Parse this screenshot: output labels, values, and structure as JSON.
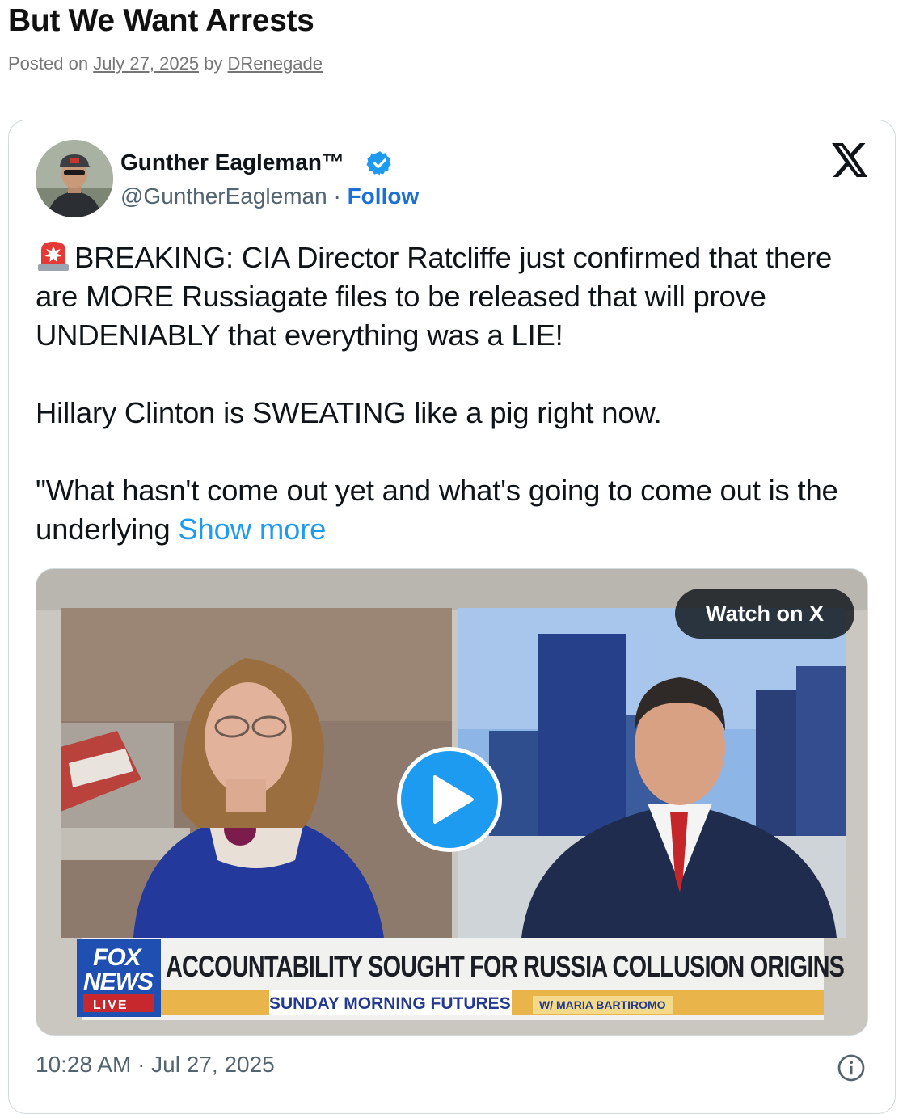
{
  "post": {
    "title": "But We Want Arrests",
    "meta_prefix": "Posted on ",
    "date": "July 27, 2025",
    "by": " by ",
    "author": "DRenegade"
  },
  "tweet": {
    "author_name": "Gunther Eagleman™",
    "handle": "@GuntherEagleman",
    "separator": " · ",
    "follow_label": "Follow",
    "text_line1": "BREAKING: CIA Director Ratcliffe just confirmed that there are MORE Russiagate files to be released that will prove UNDENIABLY that everything was a LIE!",
    "text_line2": "Hillary Clinton is SWEATING like a pig right now.",
    "text_line3": "\"What hasn't come out yet and what's going to come out is the underlying ",
    "show_more": "Show more",
    "timestamp": "10:28 AM · Jul 27, 2025",
    "icons": {
      "verified": "verified-badge-icon",
      "platform": "x-logo-icon",
      "siren": "rotating-light-emoji",
      "info": "info-icon",
      "play": "play-icon"
    },
    "colors": {
      "accent": "#1d9bf0",
      "follow": "#1d6fd6",
      "muted": "#536471"
    }
  },
  "video": {
    "watch_label": "Watch on X",
    "network_top": "FOX",
    "network_bottom": "NEWS",
    "live_label": "LIVE",
    "chyron": "ACCOUNTABILITY SOUGHT FOR RUSSIA COLLUSION ORIGINS",
    "show_name": "SUNDAY MORNING FUTURES",
    "host": "W/ MARIA BARTIROMO"
  }
}
